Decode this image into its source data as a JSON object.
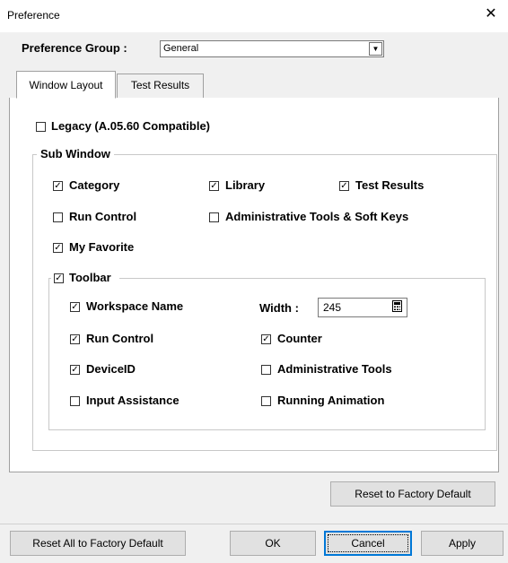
{
  "window": {
    "title": "Preference",
    "close_glyph": "✕"
  },
  "preference_group": {
    "label": "Preference Group :",
    "value": "General"
  },
  "tabs": [
    {
      "label": "Window Layout",
      "active": true
    },
    {
      "label": "Test Results",
      "active": false
    }
  ],
  "legacy": {
    "label": "Legacy (A.05.60 Compatible)",
    "checked": false
  },
  "sub_window": {
    "label": "Sub Window",
    "category": {
      "label": "Category",
      "checked": true
    },
    "library": {
      "label": "Library",
      "checked": true
    },
    "test_results": {
      "label": "Test Results",
      "checked": true
    },
    "run_control": {
      "label": "Run Control",
      "checked": false
    },
    "admin_soft_keys": {
      "label": "Administrative Tools & Soft Keys",
      "checked": false
    },
    "my_favorite": {
      "label": "My Favorite",
      "checked": true
    }
  },
  "toolbar": {
    "label": "Toolbar",
    "checked": true,
    "workspace_name": {
      "label": "Workspace Name",
      "checked": true
    },
    "width": {
      "label": "Width :",
      "value": "245"
    },
    "run_control": {
      "label": "Run Control",
      "checked": true
    },
    "counter": {
      "label": "Counter",
      "checked": true
    },
    "device_id": {
      "label": "DeviceID",
      "checked": true
    },
    "admin_tools": {
      "label": "Administrative Tools",
      "checked": false
    },
    "input_assistance": {
      "label": "Input Assistance",
      "checked": false
    },
    "running_animation": {
      "label": "Running Animation",
      "checked": false
    }
  },
  "buttons": {
    "reset_factory": "Reset to Factory Default",
    "reset_all": "Reset All to Factory Default",
    "ok": "OK",
    "cancel": "Cancel",
    "apply": "Apply"
  },
  "check_glyph": "✓"
}
